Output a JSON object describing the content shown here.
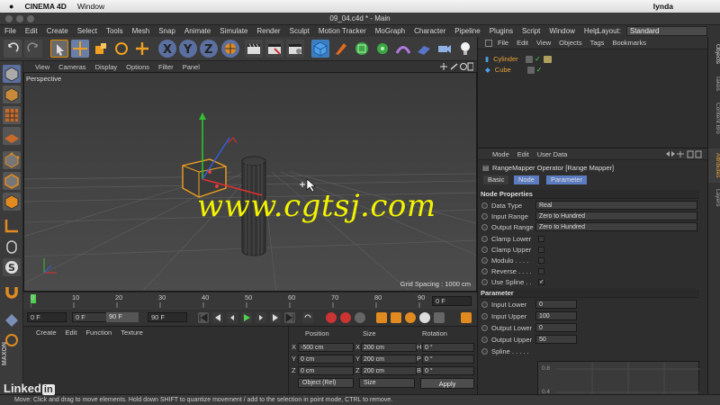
{
  "mac_menu": {
    "app": "CINEMA 4D",
    "window": "Window",
    "user": "lynda"
  },
  "window_title": "09_04.c4d * - Main",
  "menu": [
    "File",
    "Edit",
    "Create",
    "Select",
    "Tools",
    "Mesh",
    "Snap",
    "Animate",
    "Simulate",
    "Render",
    "Sculpt",
    "Motion Tracker",
    "MoGraph",
    "Character",
    "Pipeline",
    "Plugins",
    "Script",
    "Window",
    "Help"
  ],
  "layout": {
    "label": "Layout:",
    "value": "Standard"
  },
  "viewport_menu": [
    "View",
    "Cameras",
    "Display",
    "Options",
    "Filter",
    "Panel"
  ],
  "viewport": {
    "camera": "Perspective",
    "grid_spacing": "Grid Spacing : 1000 cm"
  },
  "watermark": "www.cgtsj.com",
  "timeline": {
    "ticks": [
      "0",
      "10",
      "20",
      "30",
      "40",
      "50",
      "60",
      "70",
      "80",
      "90"
    ],
    "frame_end_label": "0 F",
    "start": "0 F",
    "preview_start": "0 F",
    "preview_end": "90 F",
    "end": "90 F"
  },
  "material_menu": [
    "Create",
    "Edit",
    "Function",
    "Texture"
  ],
  "coordinates": {
    "headers": [
      "Position",
      "Size",
      "Rotation"
    ],
    "rows": [
      {
        "axis": "X",
        "pos": "-500 cm",
        "size_axis": "X",
        "size": "200 cm",
        "rot_axis": "H",
        "rot": "0 °"
      },
      {
        "axis": "Y",
        "pos": "0 cm",
        "size_axis": "Y",
        "size": "200 cm",
        "rot_axis": "P",
        "rot": "0 °"
      },
      {
        "axis": "Z",
        "pos": "0 cm",
        "size_axis": "Z",
        "size": "200 cm",
        "rot_axis": "B",
        "rot": "0 °"
      }
    ],
    "mode_select": "Object (Rel)",
    "size_select": "Size",
    "apply": "Apply"
  },
  "object_menu": [
    "File",
    "Edit",
    "View",
    "Objects",
    "Tags",
    "Bookmarks"
  ],
  "objects": [
    {
      "name": "Cylinder",
      "color": "#e8a23c"
    },
    {
      "name": "Cube",
      "color": "#e8a23c"
    }
  ],
  "attr_menu": [
    "Mode",
    "Edit",
    "User Data"
  ],
  "operator_name": "RangeMapper Operator [Range Mapper]",
  "attr_tabs": [
    "Basic",
    "Node",
    "Parameter"
  ],
  "node_properties": {
    "title": "Node Properties",
    "rows": [
      {
        "label": "Data Type",
        "value": "Real"
      },
      {
        "label": "Input Range",
        "value": "Zero to Hundred"
      },
      {
        "label": "Output Range",
        "value": "Zero to Hundred"
      }
    ],
    "checks": [
      {
        "label": "Clamp Lower",
        "checked": ""
      },
      {
        "label": "Clamp Upper",
        "checked": ""
      },
      {
        "label": "Modulo . . . .",
        "checked": ""
      },
      {
        "label": "Reverse . . . .",
        "checked": ""
      },
      {
        "label": "Use Spline . .",
        "checked": "✓"
      }
    ]
  },
  "parameter": {
    "title": "Parameter",
    "rows": [
      {
        "label": "Input Lower",
        "value": "0"
      },
      {
        "label": "Input Upper",
        "value": "100"
      },
      {
        "label": "Output Lower",
        "value": "0"
      },
      {
        "label": "Output Upper",
        "value": "50"
      }
    ],
    "spline_label": "Spline . . . . .",
    "spline_ticks": [
      "0.8",
      "0.4"
    ]
  },
  "right_tabs": [
    "Objects",
    "Takes",
    "Content Bro",
    "Attributes",
    "Layers"
  ],
  "status": "Move: Click and drag to move elements. Hold down SHIFT to quantize movement / add to the selection in point mode, CTRL to remove.",
  "branding": {
    "linkedin": "Linked",
    "linkedin_in": "in",
    "maxon": "MAXON"
  }
}
